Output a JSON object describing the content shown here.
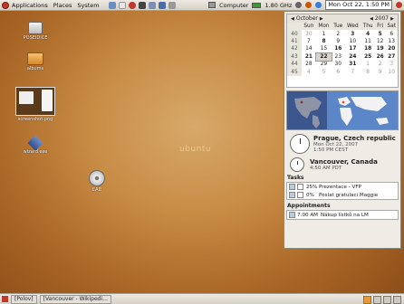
{
  "top_panel": {
    "menus": [
      "Applications",
      "Places",
      "System"
    ],
    "network_label": "Computer",
    "cpu_freq": "1.80 GHz",
    "clock": "Mon Oct 22, 1:50 PM"
  },
  "desktop": {
    "icons": [
      {
        "label": "POSEIDICE"
      },
      {
        "label": "albums"
      },
      {
        "label": "screenshot.png"
      },
      {
        "label": "wizard.exe"
      },
      {
        "label": "CAD"
      }
    ],
    "watermark": "ubuntu"
  },
  "calendar": {
    "month": "October",
    "year": "2007",
    "weekdays": [
      "Sun",
      "Mon",
      "Tue",
      "Wed",
      "Thu",
      "Fri",
      "Sat"
    ],
    "weeks": [
      {
        "wk": "40",
        "days": [
          "30",
          "1",
          "2",
          "3",
          "4",
          "5",
          "6"
        ]
      },
      {
        "wk": "41",
        "days": [
          "7",
          "8",
          "9",
          "10",
          "11",
          "12",
          "13"
        ]
      },
      {
        "wk": "42",
        "days": [
          "14",
          "15",
          "16",
          "17",
          "18",
          "19",
          "20"
        ]
      },
      {
        "wk": "43",
        "days": [
          "21",
          "22",
          "23",
          "24",
          "25",
          "26",
          "27"
        ]
      },
      {
        "wk": "44",
        "days": [
          "28",
          "29",
          "30",
          "31",
          "1",
          "2",
          "3"
        ]
      },
      {
        "wk": "45",
        "days": [
          "4",
          "5",
          "6",
          "7",
          "8",
          "9",
          "10"
        ]
      }
    ],
    "today": "22"
  },
  "locations": [
    {
      "name": "Prague, Czech republic",
      "date": "Mon Oct 22, 2007",
      "time": "1:50 PM CEST"
    },
    {
      "name": "Vancouver, Canada",
      "time": "4:50 AM PDT"
    }
  ],
  "tasks": {
    "header": "Tasks",
    "items": [
      {
        "pct": "25%",
        "title": "Prezentace - VFP"
      },
      {
        "pct": "0%",
        "title": "Poslat gratulaci Maggie"
      }
    ]
  },
  "appointments": {
    "header": "Appointments",
    "items": [
      {
        "time": "7:00 AM",
        "title": "Nákup lístků na LM"
      }
    ]
  },
  "taskbar": {
    "items": [
      "[Polov]",
      "[Vancouver - Wikipedi..."
    ]
  },
  "colors": {
    "desktop": "#c88c45",
    "panel": "#e2ddd3",
    "map_ocean": "#5b86c8"
  }
}
